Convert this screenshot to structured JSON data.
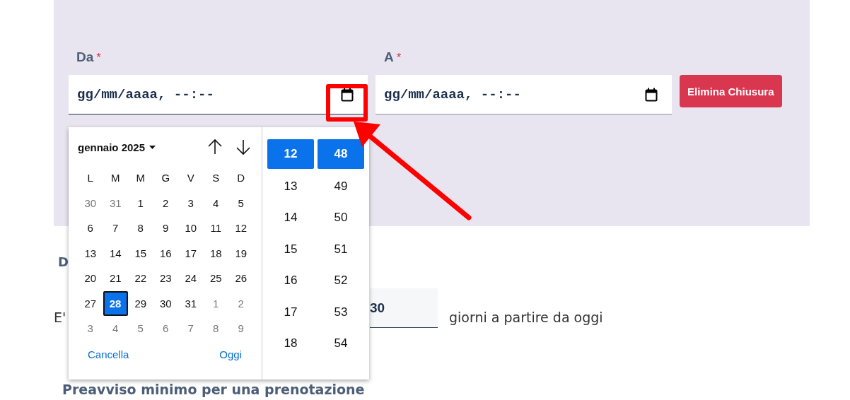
{
  "range": {
    "from": {
      "label": "Da",
      "required_mark": "*",
      "placeholder": "gg/mm/aaaa, --:--"
    },
    "to": {
      "label": "A",
      "required_mark": "*",
      "placeholder": "gg/mm/aaaa, --:--"
    },
    "delete_button": "Elimina Chiusura"
  },
  "below": {
    "label_1": "D",
    "sentence_start": "E'",
    "days_field": {
      "value": "30"
    },
    "days_suffix": "giorni a partire da oggi",
    "label_2": "Preavviso minimo per una prenotazione"
  },
  "picker": {
    "month_label": "gennaio 2025",
    "weekdays": [
      "L",
      "M",
      "M",
      "G",
      "V",
      "S",
      "D"
    ],
    "days": [
      {
        "label": "30",
        "outside": true,
        "selected": false
      },
      {
        "label": "31",
        "outside": true,
        "selected": false
      },
      {
        "label": "1",
        "outside": false,
        "selected": false
      },
      {
        "label": "2",
        "outside": false,
        "selected": false
      },
      {
        "label": "3",
        "outside": false,
        "selected": false
      },
      {
        "label": "4",
        "outside": false,
        "selected": false
      },
      {
        "label": "5",
        "outside": false,
        "selected": false
      },
      {
        "label": "6",
        "outside": false,
        "selected": false
      },
      {
        "label": "7",
        "outside": false,
        "selected": false
      },
      {
        "label": "8",
        "outside": false,
        "selected": false
      },
      {
        "label": "9",
        "outside": false,
        "selected": false
      },
      {
        "label": "10",
        "outside": false,
        "selected": false
      },
      {
        "label": "11",
        "outside": false,
        "selected": false
      },
      {
        "label": "12",
        "outside": false,
        "selected": false
      },
      {
        "label": "13",
        "outside": false,
        "selected": false
      },
      {
        "label": "14",
        "outside": false,
        "selected": false
      },
      {
        "label": "15",
        "outside": false,
        "selected": false
      },
      {
        "label": "16",
        "outside": false,
        "selected": false
      },
      {
        "label": "17",
        "outside": false,
        "selected": false
      },
      {
        "label": "18",
        "outside": false,
        "selected": false
      },
      {
        "label": "19",
        "outside": false,
        "selected": false
      },
      {
        "label": "20",
        "outside": false,
        "selected": false
      },
      {
        "label": "21",
        "outside": false,
        "selected": false
      },
      {
        "label": "22",
        "outside": false,
        "selected": false
      },
      {
        "label": "23",
        "outside": false,
        "selected": false
      },
      {
        "label": "24",
        "outside": false,
        "selected": false
      },
      {
        "label": "25",
        "outside": false,
        "selected": false
      },
      {
        "label": "26",
        "outside": false,
        "selected": false
      },
      {
        "label": "27",
        "outside": false,
        "selected": false
      },
      {
        "label": "28",
        "outside": false,
        "selected": true
      },
      {
        "label": "29",
        "outside": false,
        "selected": false
      },
      {
        "label": "30",
        "outside": false,
        "selected": false
      },
      {
        "label": "31",
        "outside": false,
        "selected": false
      },
      {
        "label": "1",
        "outside": true,
        "selected": false
      },
      {
        "label": "2",
        "outside": true,
        "selected": false
      },
      {
        "label": "3",
        "outside": true,
        "selected": false
      },
      {
        "label": "4",
        "outside": true,
        "selected": false
      },
      {
        "label": "5",
        "outside": true,
        "selected": false
      },
      {
        "label": "6",
        "outside": true,
        "selected": false
      },
      {
        "label": "7",
        "outside": true,
        "selected": false
      },
      {
        "label": "8",
        "outside": true,
        "selected": false
      },
      {
        "label": "9",
        "outside": true,
        "selected": false
      }
    ],
    "clear_link": "Cancella",
    "today_link": "Oggi",
    "hours": [
      {
        "label": "12",
        "selected": true
      },
      {
        "label": "13",
        "selected": false
      },
      {
        "label": "14",
        "selected": false
      },
      {
        "label": "15",
        "selected": false
      },
      {
        "label": "16",
        "selected": false
      },
      {
        "label": "17",
        "selected": false
      },
      {
        "label": "18",
        "selected": false
      }
    ],
    "minutes": [
      {
        "label": "48",
        "selected": true
      },
      {
        "label": "49",
        "selected": false
      },
      {
        "label": "50",
        "selected": false
      },
      {
        "label": "51",
        "selected": false
      },
      {
        "label": "52",
        "selected": false
      },
      {
        "label": "53",
        "selected": false
      },
      {
        "label": "54",
        "selected": false
      }
    ]
  }
}
